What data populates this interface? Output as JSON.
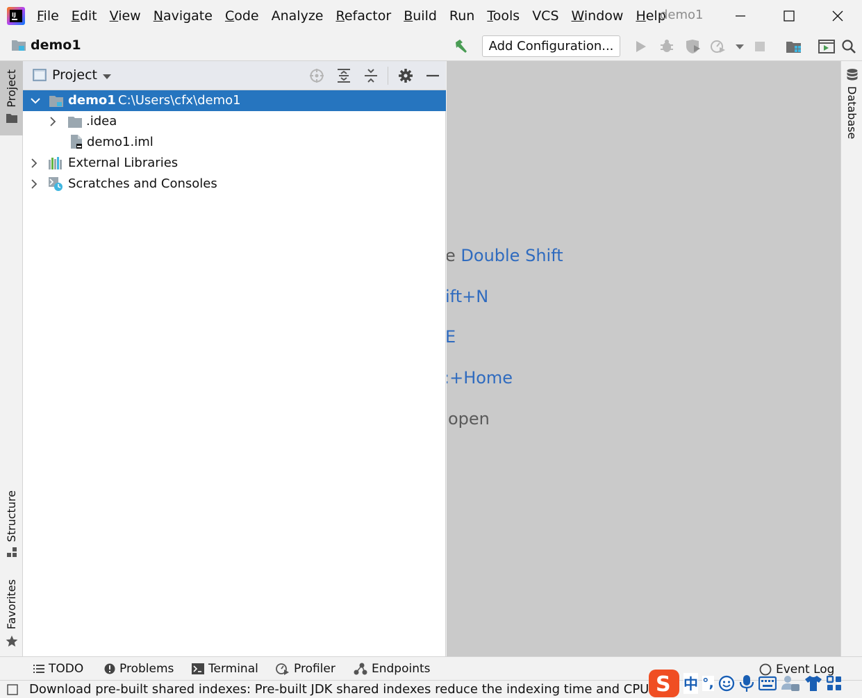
{
  "menu": {
    "items": [
      {
        "label": "File",
        "mnemonic": "F",
        "rest": "ile"
      },
      {
        "label": "Edit",
        "mnemonic": "E",
        "rest": "dit"
      },
      {
        "label": "View",
        "mnemonic": "V",
        "rest": "iew"
      },
      {
        "label": "Navigate",
        "mnemonic": "N",
        "rest": "avigate"
      },
      {
        "label": "Code",
        "mnemonic": "C",
        "rest": "ode"
      },
      {
        "label": "Analyze",
        "mnemonic": "",
        "rest": "Analyze"
      },
      {
        "label": "Refactor",
        "mnemonic": "R",
        "rest": "efactor"
      },
      {
        "label": "Build",
        "mnemonic": "B",
        "rest": "uild"
      },
      {
        "label": "Run",
        "mnemonic": "",
        "rest": "Run"
      },
      {
        "label": "Tools",
        "mnemonic": "T",
        "rest": "ools"
      },
      {
        "label": "VCS",
        "mnemonic": "",
        "rest": "VCS"
      },
      {
        "label": "Window",
        "mnemonic": "W",
        "rest": "indow"
      },
      {
        "label": "Help",
        "mnemonic": "H",
        "rest": "elp"
      }
    ],
    "window_title": "demo1"
  },
  "navbar": {
    "project_name": "demo1",
    "add_configuration": "Add Configuration..."
  },
  "left_strip": {
    "project_tab": "Project",
    "structure_tab": "Structure",
    "favorites_tab": "Favorites"
  },
  "right_strip": {
    "database_tab": "Database"
  },
  "project_panel": {
    "title": "Project",
    "tree": [
      {
        "label": "demo1",
        "path": "C:\\Users\\cfx\\demo1"
      },
      {
        "label": ".idea"
      },
      {
        "label": "demo1.iml"
      },
      {
        "label": "External Libraries"
      },
      {
        "label": "Scratches and Consoles"
      }
    ]
  },
  "editor": {
    "hints": [
      {
        "prefix": "e ",
        "shortcut": "Double Shift"
      },
      {
        "prefix": "",
        "shortcut": "ift+N"
      },
      {
        "prefix": "",
        "shortcut": "E"
      },
      {
        "prefix": "",
        "shortcut": ":+Home"
      },
      {
        "prefix": "open",
        "shortcut": ""
      }
    ]
  },
  "bottombar": {
    "tabs": [
      "TODO",
      "Problems",
      "Terminal",
      "Profiler",
      "Endpoints"
    ],
    "event_log": "Event Log"
  },
  "status": {
    "message": "Download pre-built shared indexes: Pre-built JDK shared indexes reduce the indexing time and CPU load"
  },
  "ime": {
    "mode": "中",
    "punct": "°,"
  },
  "colors": {
    "selection": "#2675bf",
    "hint_blue": "#2f6bbf",
    "editor_bg": "#cacaca",
    "run_green": "#499c54"
  }
}
